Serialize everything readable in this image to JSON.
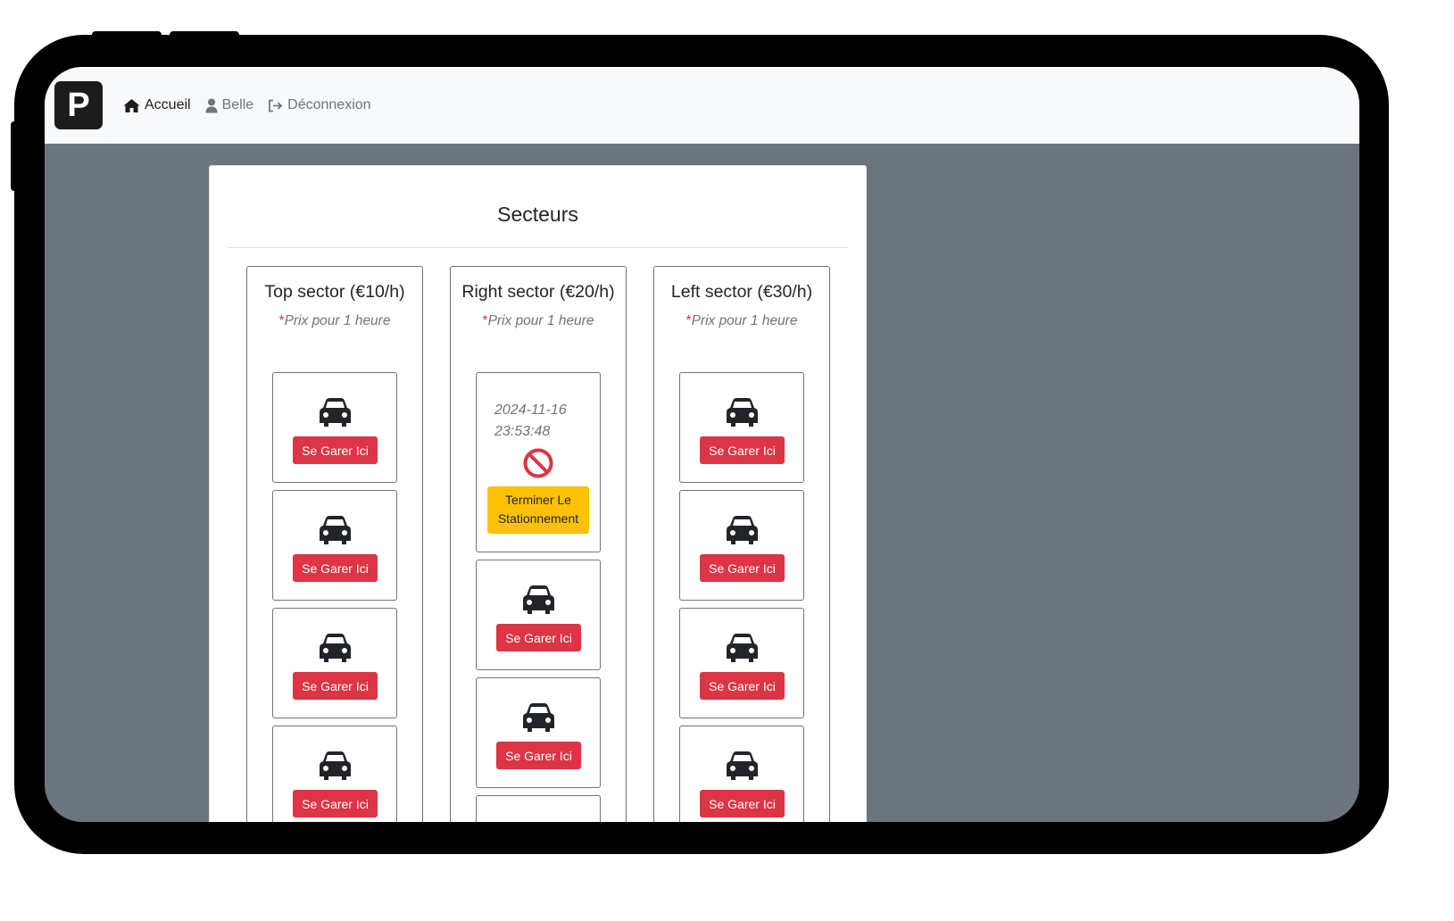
{
  "navbar": {
    "logo_letter": "P",
    "links": {
      "home": "Accueil",
      "user": "Belle",
      "logout": "Déconnexion"
    }
  },
  "page": {
    "title": "Secteurs"
  },
  "sectors": [
    {
      "name": "Top sector (€10/h)",
      "note_star": "*",
      "note": "Prix pour 1 heure",
      "spots": [
        {
          "button": "Se Garer Ici"
        },
        {
          "button": "Se Garer Ici"
        },
        {
          "button": "Se Garer Ici"
        },
        {
          "button": "Se Garer Ici"
        }
      ]
    },
    {
      "name": "Right sector (€20/h)",
      "note_star": "*",
      "note": "Prix pour 1 heure",
      "occupied": {
        "date": "2024-11-16",
        "time": "23:53:48",
        "icon": "no-parking-icon",
        "button_line1": "Terminer Le",
        "button_line2": "Stationnement"
      },
      "spots": [
        {
          "button": "Se Garer Ici"
        },
        {
          "button": "Se Garer Ici"
        }
      ]
    },
    {
      "name": "Left sector (€30/h)",
      "note_star": "*",
      "note": "Prix pour 1 heure",
      "spots": [
        {
          "button": "Se Garer Ici"
        },
        {
          "button": "Se Garer Ici"
        },
        {
          "button": "Se Garer Ici"
        },
        {
          "button": "Se Garer Ici"
        }
      ]
    }
  ],
  "colors": {
    "background": "#6c757d",
    "navbar": "#f8f9fa",
    "danger": "#dc3545",
    "warning": "#ffc107",
    "text": "#212529"
  }
}
